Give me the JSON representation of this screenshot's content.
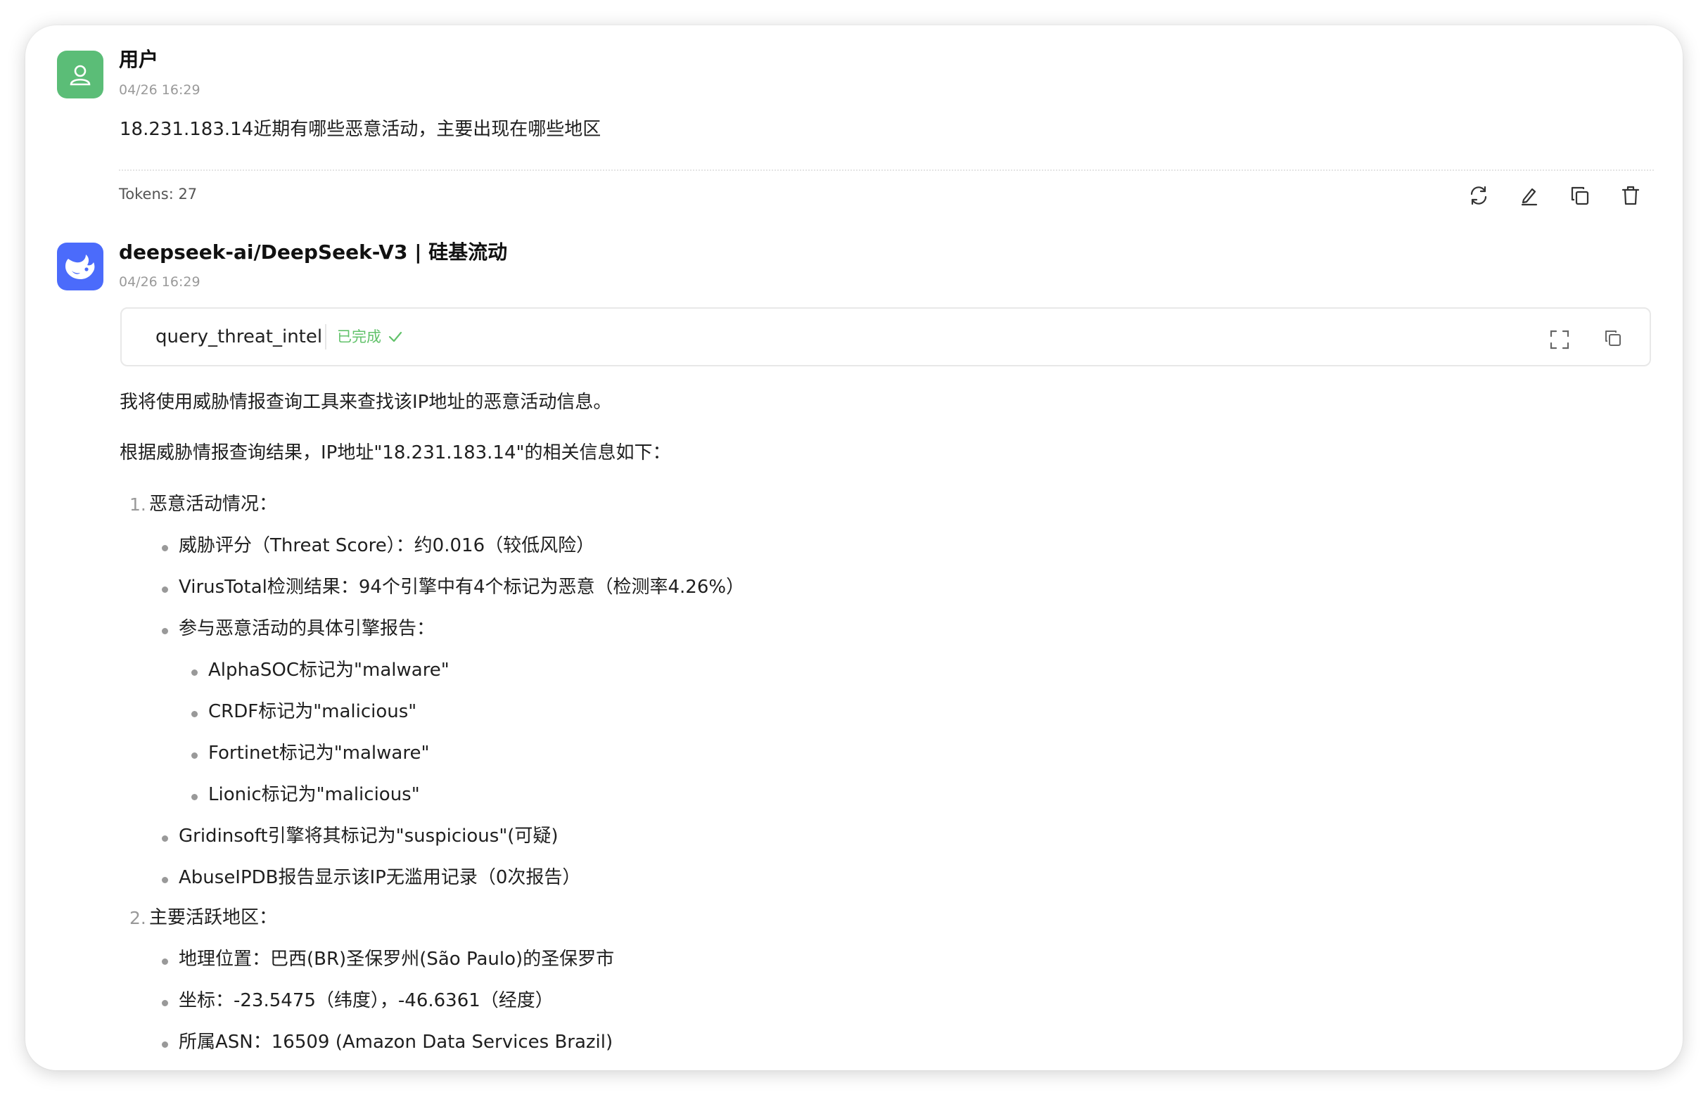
{
  "user_message": {
    "sender": "用户",
    "time": "04/26 16:29",
    "text": "18.231.183.14近期有哪些恶意活动，主要出现在哪些地区",
    "tokens": "Tokens: 27",
    "actions": [
      "refresh-icon",
      "edit-icon",
      "copy-icon",
      "delete-icon"
    ]
  },
  "ai_message": {
    "sender": "deepseek-ai/DeepSeek-V3 | 硅基流动",
    "time": "04/26 16:29",
    "tool_call": {
      "name": "query_threat_intel",
      "status": "已完成"
    },
    "paragraphs": [
      "我将使用威胁情报查询工具来查找该IP地址的恶意活动信息。",
      "根据威胁情报查询结果，IP地址\"18.231.183.14\"的相关信息如下："
    ],
    "sections": [
      {
        "number": "1.",
        "title": "恶意活动情况：",
        "items": [
          "威胁评分（Threat Score）：约0.016（较低风险）",
          "VirusTotal检测结果：94个引擎中有4个标记为恶意（检测率4.26%）",
          "参与恶意活动的具体引擎报告："
        ],
        "subitems": [
          "AlphaSOC标记为\"malware\"",
          "CRDF标记为\"malicious\"",
          "Fortinet标记为\"malware\"",
          "Lionic标记为\"malicious\""
        ],
        "items_after": [
          "Gridinsoft引擎将其标记为\"suspicious\"(可疑)",
          "AbuseIPDB报告显示该IP无滥用记录（0次报告）"
        ]
      },
      {
        "number": "2.",
        "title": "主要活跃地区：",
        "items": [
          "地理位置：巴西(BR)圣保罗州(São Paulo)的圣保罗市",
          "坐标：-23.5475（纬度），-46.6361（经度）",
          "所属ASN：16509 (Amazon Data Services Brazil)"
        ]
      }
    ]
  },
  "colors": {
    "user_avatar": "#5bbd77",
    "ai_avatar": "#4b6bfb",
    "status_done": "#62c26b"
  }
}
